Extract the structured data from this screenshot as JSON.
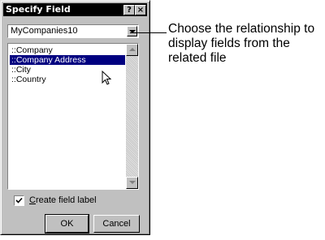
{
  "dialog": {
    "title": "Specify Field",
    "help_label": "?",
    "close_label": "×",
    "relationship_combo": {
      "value": "MyCompanies10"
    },
    "fields": [
      {
        "label": "::Company",
        "selected": false
      },
      {
        "label": "::Company Address",
        "selected": true
      },
      {
        "label": "::City",
        "selected": false
      },
      {
        "label": "::Country",
        "selected": false
      }
    ],
    "create_label": {
      "checked": true,
      "prefix": "C",
      "rest": "reate field label"
    },
    "ok_label": "OK",
    "cancel_label": "Cancel"
  },
  "callout": {
    "text": "Choose the relationship to display fields from the related file"
  },
  "icons": [
    "help-icon",
    "close-icon",
    "dropdown-arrow-icon",
    "scroll-up-icon",
    "scroll-down-icon",
    "checkmark-icon",
    "mouse-pointer-icon"
  ]
}
